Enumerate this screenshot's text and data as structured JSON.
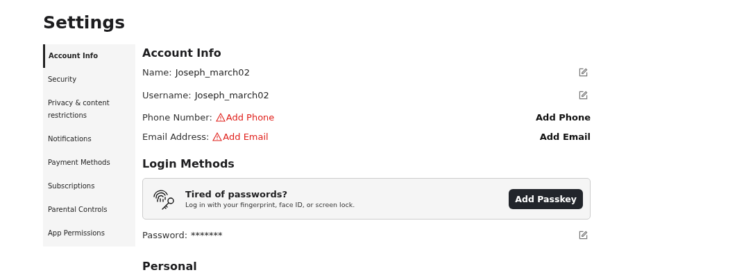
{
  "title": "Settings",
  "sidebar": {
    "items": [
      {
        "label": "Account Info",
        "selected": true
      },
      {
        "label": "Security",
        "selected": false
      },
      {
        "label": "Privacy & content restrictions",
        "selected": false
      },
      {
        "label": "Notifications",
        "selected": false
      },
      {
        "label": "Payment Methods",
        "selected": false
      },
      {
        "label": "Subscriptions",
        "selected": false
      },
      {
        "label": "Parental Controls",
        "selected": false
      },
      {
        "label": "App Permissions",
        "selected": false
      }
    ]
  },
  "account_info": {
    "heading": "Account Info",
    "rows": [
      {
        "kind": "edit",
        "label": "Name:",
        "value": "Joseph_march02"
      },
      {
        "kind": "edit",
        "label": "Username:",
        "value": "Joseph_march02"
      },
      {
        "kind": "add",
        "label": "Phone Number:",
        "warning": "Add Phone",
        "action": "Add Phone"
      },
      {
        "kind": "add",
        "label": "Email Address:",
        "warning": "Add Email",
        "action": "Add Email"
      }
    ]
  },
  "login_methods": {
    "heading": "Login Methods",
    "passkey_card": {
      "title": "Tired of passwords?",
      "description": "Log in with your fingerprint, face ID, or screen lock.",
      "button": "Add Passkey"
    },
    "rows": [
      {
        "kind": "edit",
        "label": "Password:",
        "value": "*******"
      }
    ]
  },
  "personal": {
    "heading": "Personal"
  }
}
